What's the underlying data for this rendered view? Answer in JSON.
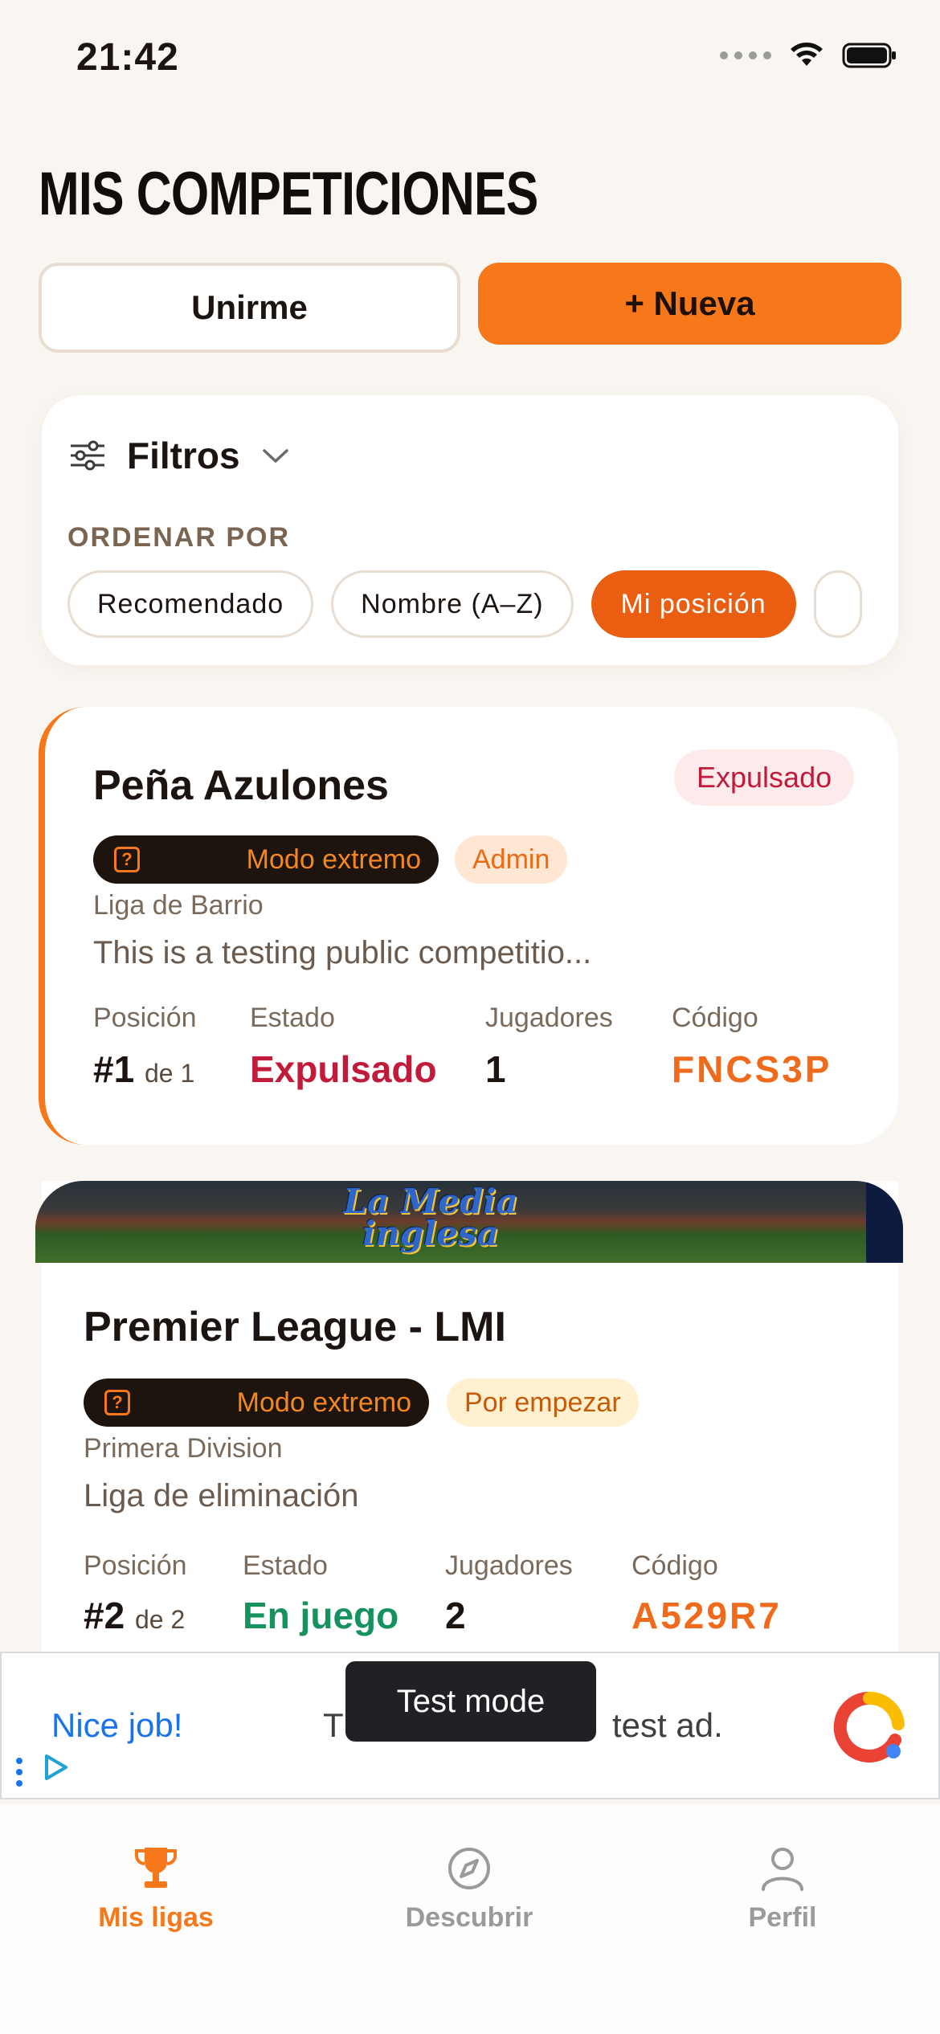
{
  "status_bar": {
    "time": "21:42"
  },
  "page": {
    "title": "MIS COMPETICIONES"
  },
  "actions": {
    "join_label": "Unirme",
    "new_label": "+ Nueva"
  },
  "filters": {
    "title": "Filtros",
    "order_label": "ORDENAR POR",
    "chips": [
      "Recomendado",
      "Nombre (A–Z)",
      "Mi posición"
    ],
    "selected": "Mi posición"
  },
  "competitions": [
    {
      "name": "Peña Azulones",
      "status_badge": "Expulsado",
      "mode": "Modo extremo",
      "tag": "Admin",
      "league": "Liga de Barrio",
      "description": "This is a testing public competitio...",
      "labels": {
        "position": "Posición",
        "state": "Estado",
        "players": "Jugadores",
        "code": "Código"
      },
      "position": "#1",
      "position_of": "de 1",
      "state": "Expulsado",
      "players": "1",
      "code": "FNCS3P"
    },
    {
      "name": "Premier League - LMI",
      "mode": "Modo extremo",
      "tag": "Por empezar",
      "league": "Primera Division",
      "description": "Liga de eliminación",
      "labels": {
        "position": "Posición",
        "state": "Estado",
        "players": "Jugadores",
        "code": "Código"
      },
      "position": "#2",
      "position_of": "de 2",
      "state": "En juego",
      "players": "2",
      "code": "A529R7"
    }
  ],
  "ad": {
    "headline": "Nice job!",
    "text_start": "T",
    "text_end": "test ad.",
    "toast": "Test mode"
  },
  "tabs": [
    {
      "label": "Mis ligas",
      "icon": "trophy-icon",
      "active": true
    },
    {
      "label": "Descubrir",
      "icon": "compass-icon",
      "active": false
    },
    {
      "label": "Perfil",
      "icon": "person-icon",
      "active": false
    }
  ],
  "colors": {
    "accent": "#f6781a",
    "selected_chip": "#ea5e12",
    "danger": "#c21a3b",
    "success": "#16925e"
  }
}
